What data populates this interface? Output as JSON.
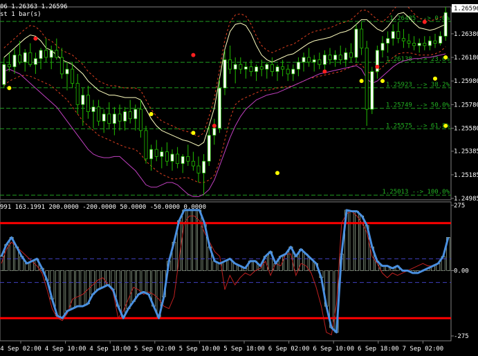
{
  "header": {
    "ohlc_text": "06 1.26363 1.26596",
    "shift_text": "st 1 bar(s)",
    "indicator_params": "991 163.1991 200.0000 -200.0000 50.0000 -50.0000 0.0000"
  },
  "colors": {
    "background": "#000000",
    "bull_candle": "#ffffff",
    "candle_outline": "#22c000",
    "bear_candle": "#000000",
    "upper_band": "#ffffc0",
    "envelope": "#e04020",
    "lower_band": "#c040c0",
    "fib_line": "#22a022",
    "fractal_up": "#ff2020",
    "fractal_down": "#ffff00",
    "cci_main": "#4a90e0",
    "cci_signal": "#c02020",
    "level_line": "#ff0000",
    "dash_level": "#4040c0"
  },
  "chart_data": [
    {
      "type": "candlestick",
      "price_axis_labels": [
        "1.26596",
        "1.26380",
        "1.26180",
        "1.25980",
        "1.25780",
        "1.25580",
        "1.25385",
        "1.25185",
        "1.24985"
      ],
      "current_price": "1.26596",
      "ylim": [
        1.24985,
        1.26596
      ],
      "fibonacci_levels": [
        {
          "label": "1.26485 --> 0.0%",
          "value": 1.26485
        },
        {
          "label": "1.26138 --> 23.6%",
          "value": 1.26138
        },
        {
          "label": "1.25923 --> 38.2%",
          "value": 1.25923
        },
        {
          "label": "1.25749 --> 50.0%",
          "value": 1.25749
        },
        {
          "label": "1.25575 --> 61.8%",
          "value": 1.25575
        },
        {
          "label": "1.25013 --> 100.0%",
          "value": 1.25013
        }
      ],
      "candles": [
        [
          1.2595,
          1.2618,
          1.2592,
          1.2612
        ],
        [
          1.2612,
          1.2622,
          1.2606,
          1.261
        ],
        [
          1.261,
          1.2626,
          1.2604,
          1.262
        ],
        [
          1.262,
          1.2632,
          1.2612,
          1.2614
        ],
        [
          1.2614,
          1.2625,
          1.2606,
          1.2622
        ],
        [
          1.2622,
          1.263,
          1.261,
          1.2612
        ],
        [
          1.2612,
          1.2622,
          1.2604,
          1.2617
        ],
        [
          1.2617,
          1.2626,
          1.2608,
          1.2624
        ],
        [
          1.2624,
          1.2634,
          1.2614,
          1.2618
        ],
        [
          1.2618,
          1.2628,
          1.2608,
          1.2624
        ],
        [
          1.2624,
          1.2634,
          1.2616,
          1.2618
        ],
        [
          1.2618,
          1.2626,
          1.26,
          1.2604
        ],
        [
          1.2604,
          1.2614,
          1.259,
          1.2608
        ],
        [
          1.2608,
          1.2614,
          1.2592,
          1.2596
        ],
        [
          1.2596,
          1.2604,
          1.257,
          1.2578
        ],
        [
          1.2578,
          1.2592,
          1.256,
          1.2586
        ],
        [
          1.2586,
          1.2594,
          1.2566,
          1.2572
        ],
        [
          1.2572,
          1.2582,
          1.2558,
          1.2576
        ],
        [
          1.2576,
          1.2582,
          1.256,
          1.2564
        ],
        [
          1.2564,
          1.2574,
          1.2554,
          1.257
        ],
        [
          1.257,
          1.258,
          1.2558,
          1.2562
        ],
        [
          1.2562,
          1.2576,
          1.2552,
          1.257
        ],
        [
          1.257,
          1.2578,
          1.2556,
          1.2564
        ],
        [
          1.2564,
          1.2576,
          1.2556,
          1.2572
        ],
        [
          1.2572,
          1.2582,
          1.2562,
          1.2566
        ],
        [
          1.2566,
          1.2578,
          1.2556,
          1.2574
        ],
        [
          1.2574,
          1.2582,
          1.255,
          1.2556
        ],
        [
          1.2556,
          1.256,
          1.2528,
          1.2532
        ],
        [
          1.2532,
          1.2544,
          1.2522,
          1.254
        ],
        [
          1.254,
          1.2548,
          1.253,
          1.2534
        ],
        [
          1.2534,
          1.2542,
          1.2524,
          1.2538
        ],
        [
          1.2538,
          1.2546,
          1.2526,
          1.253
        ],
        [
          1.253,
          1.254,
          1.2522,
          1.2536
        ],
        [
          1.2536,
          1.2542,
          1.2524,
          1.2528
        ],
        [
          1.2528,
          1.2536,
          1.252,
          1.2534
        ],
        [
          1.2534,
          1.2544,
          1.2526,
          1.253
        ],
        [
          1.253,
          1.2538,
          1.2522,
          1.2526
        ],
        [
          1.2526,
          1.2534,
          1.2512,
          1.252
        ],
        [
          1.252,
          1.2536,
          1.2501,
          1.253
        ],
        [
          1.253,
          1.256,
          1.2526,
          1.2552
        ],
        [
          1.2552,
          1.2566,
          1.2544,
          1.2558
        ],
        [
          1.2558,
          1.26,
          1.2554,
          1.2592
        ],
        [
          1.2592,
          1.2624,
          1.2586,
          1.2616
        ],
        [
          1.2616,
          1.2628,
          1.2604,
          1.2608
        ],
        [
          1.2608,
          1.2618,
          1.2596,
          1.2612
        ],
        [
          1.2612,
          1.2618,
          1.2604,
          1.2608
        ],
        [
          1.2608,
          1.2614,
          1.26,
          1.261
        ],
        [
          1.261,
          1.2616,
          1.2602,
          1.2606
        ],
        [
          1.2606,
          1.2612,
          1.2598,
          1.261
        ],
        [
          1.261,
          1.2616,
          1.2602,
          1.2608
        ],
        [
          1.2608,
          1.2614,
          1.26,
          1.2612
        ],
        [
          1.2612,
          1.2618,
          1.2602,
          1.2606
        ],
        [
          1.2606,
          1.2612,
          1.2598,
          1.261
        ],
        [
          1.261,
          1.2616,
          1.2602,
          1.2608
        ],
        [
          1.2608,
          1.2612,
          1.2598,
          1.2604
        ],
        [
          1.2604,
          1.2612,
          1.2598,
          1.2608
        ],
        [
          1.2608,
          1.2618,
          1.2602,
          1.2614
        ],
        [
          1.2614,
          1.2622,
          1.2606,
          1.2618
        ],
        [
          1.2618,
          1.2626,
          1.261,
          1.2614
        ],
        [
          1.2614,
          1.262,
          1.2606,
          1.2616
        ],
        [
          1.2616,
          1.2622,
          1.2608,
          1.2612
        ],
        [
          1.2612,
          1.2624,
          1.2606,
          1.262
        ],
        [
          1.262,
          1.2626,
          1.2612,
          1.2616
        ],
        [
          1.2616,
          1.2624,
          1.261,
          1.262
        ],
        [
          1.262,
          1.2628,
          1.2612,
          1.2616
        ],
        [
          1.2616,
          1.2626,
          1.261,
          1.2622
        ],
        [
          1.2622,
          1.263,
          1.2614,
          1.2618
        ],
        [
          1.2618,
          1.2646,
          1.2614,
          1.2642
        ],
        [
          1.2642,
          1.2648,
          1.262,
          1.2626
        ],
        [
          1.2626,
          1.2632,
          1.256,
          1.2574
        ],
        [
          1.2574,
          1.261,
          1.257,
          1.2606
        ],
        [
          1.2606,
          1.2628,
          1.26,
          1.2624
        ],
        [
          1.2624,
          1.2636,
          1.2618,
          1.263
        ],
        [
          1.263,
          1.264,
          1.2622,
          1.2634
        ],
        [
          1.2634,
          1.2646,
          1.2628,
          1.264
        ],
        [
          1.264,
          1.2648,
          1.263,
          1.2634
        ],
        [
          1.2634,
          1.2642,
          1.2626,
          1.2632
        ],
        [
          1.2632,
          1.2638,
          1.2626,
          1.263
        ],
        [
          1.263,
          1.2636,
          1.2624,
          1.2628
        ],
        [
          1.2628,
          1.2634,
          1.2622,
          1.263
        ],
        [
          1.263,
          1.2636,
          1.2624,
          1.2628
        ],
        [
          1.2628,
          1.2636,
          1.2624,
          1.2632
        ],
        [
          1.2632,
          1.2638,
          1.2626,
          1.263
        ],
        [
          1.263,
          1.264,
          1.2628,
          1.2636
        ],
        [
          1.2636,
          1.2662,
          1.2632,
          1.2656
        ]
      ],
      "upper_band": [
        1.2618,
        1.2622,
        1.2626,
        1.263,
        1.2634,
        1.2637,
        1.2636,
        1.2632,
        1.2626,
        1.2624,
        1.262,
        1.2616,
        1.2614,
        1.2612,
        1.2608,
        1.2604,
        1.2598,
        1.2594,
        1.259,
        1.2588,
        1.2586,
        1.2586,
        1.2585,
        1.2584,
        1.2584,
        1.2584,
        1.2582,
        1.2574,
        1.2566,
        1.256,
        1.2556,
        1.2554,
        1.2552,
        1.255,
        1.2548,
        1.2547,
        1.2545,
        1.2543,
        1.2546,
        1.256,
        1.2575,
        1.26,
        1.2625,
        1.264,
        1.2646,
        1.2647,
        1.2645,
        1.2638,
        1.2628,
        1.262,
        1.2616,
        1.2614,
        1.2616,
        1.2618,
        1.262,
        1.2621,
        1.2624,
        1.2627,
        1.263,
        1.2632,
        1.2633,
        1.2634,
        1.2635,
        1.2637,
        1.2639,
        1.264,
        1.2642,
        1.2646,
        1.265,
        1.265,
        1.2646,
        1.2642,
        1.264,
        1.2644,
        1.265,
        1.2655,
        1.2656,
        1.2652,
        1.2647,
        1.2643,
        1.2642,
        1.2641,
        1.2642,
        1.2644,
        1.2646
      ],
      "lower_band": [
        1.2594,
        1.2598,
        1.26,
        1.2602,
        1.2603,
        1.2602,
        1.26,
        1.2598,
        1.2596,
        1.2594,
        1.259,
        1.2586,
        1.2582,
        1.2576,
        1.257,
        1.2564,
        1.256,
        1.2556,
        1.2552,
        1.255,
        1.2548,
        1.2546,
        1.2544,
        1.2542,
        1.2541,
        1.254,
        1.2536,
        1.253,
        1.2526,
        1.2522,
        1.2519,
        1.2517,
        1.2515,
        1.2515,
        1.2516,
        1.2516,
        1.2514,
        1.2512,
        1.2512,
        1.2514,
        1.2518,
        1.253,
        1.2548,
        1.2566,
        1.2578,
        1.2582,
        1.2584,
        1.2586,
        1.2588,
        1.259,
        1.259,
        1.2591,
        1.2592,
        1.2593,
        1.2593,
        1.2594,
        1.2596,
        1.2598,
        1.26,
        1.2601,
        1.2602,
        1.2603,
        1.2604,
        1.2605,
        1.2606,
        1.2608,
        1.261,
        1.2612,
        1.2612,
        1.2606,
        1.2604,
        1.2606,
        1.261,
        1.2614,
        1.2618,
        1.2621,
        1.2622,
        1.2622,
        1.2621,
        1.262,
        1.262,
        1.262,
        1.2621,
        1.2623,
        1.2627
      ],
      "lower_band_2": [
        1.2606,
        1.2608,
        1.2606,
        1.2604,
        1.26,
        1.2596,
        1.2592,
        1.2588,
        1.2584,
        1.258,
        1.2576,
        1.257,
        1.2564,
        1.2558,
        1.2552,
        1.2546,
        1.254,
        1.2536,
        1.2534,
        1.2533,
        1.2533,
        1.2534,
        1.2534,
        1.253,
        1.2526,
        1.2522,
        1.2516,
        1.251,
        1.2508,
        1.2508,
        1.251,
        1.2512,
        1.2512,
        1.251,
        1.2506,
        1.2502,
        1.25,
        1.25,
        1.2502,
        1.2506,
        1.2514,
        1.2526,
        1.2538,
        1.255,
        1.256,
        1.2568,
        1.2574,
        1.2578,
        1.2582,
        1.2584,
        1.2586,
        1.2587,
        1.2588,
        1.259,
        1.2592,
        1.2594,
        1.2596,
        1.2598,
        1.26,
        1.2602,
        1.2604,
        1.2605,
        1.2606,
        1.2607,
        1.2608,
        1.2609,
        1.261,
        1.2611,
        1.2608,
        1.26,
        1.2596,
        1.2598,
        1.2602,
        1.2606,
        1.261,
        1.2613,
        1.2615,
        1.2616,
        1.2617,
        1.2617,
        1.2618,
        1.2618,
        1.2619,
        1.262,
        1.2621
      ],
      "fractals_up": [
        [
          6,
          1.2634
        ],
        [
          36,
          1.262
        ],
        [
          40,
          1.256
        ],
        [
          61,
          1.2606
        ],
        [
          71,
          1.261
        ],
        [
          80,
          1.2648
        ]
      ],
      "fractals_down": [
        [
          1,
          1.2592
        ],
        [
          28,
          1.257
        ],
        [
          36,
          1.2554
        ],
        [
          52,
          1.252
        ],
        [
          68,
          1.2598
        ],
        [
          72,
          1.2598
        ],
        [
          82,
          1.26
        ],
        [
          95,
          1.256
        ],
        [
          131,
          1.2618
        ]
      ]
    },
    {
      "type": "line",
      "indicator": "oscillator",
      "ylim": [
        -275,
        275
      ],
      "axis_labels": [
        "275",
        "0.00",
        "-275"
      ],
      "levels": [
        200,
        -200,
        50,
        -50,
        0
      ],
      "x_labels": [
        "4 Sep 02:00",
        "4 Sep 10:00",
        "4 Sep 18:00",
        "5 Sep 02:00",
        "5 Sep 10:00",
        "5 Sep 18:00",
        "6 Sep 02:00",
        "6 Sep 10:00",
        "6 Sep 18:00",
        "7 Sep 02:00"
      ],
      "main": [
        60,
        110,
        140,
        100,
        60,
        30,
        40,
        50,
        10,
        -40,
        -120,
        -190,
        -200,
        -170,
        -160,
        -150,
        -150,
        -140,
        -100,
        -80,
        -70,
        -60,
        -80,
        -150,
        -200,
        -160,
        -130,
        -100,
        -90,
        -100,
        -150,
        -200,
        -110,
        40,
        120,
        210,
        255,
        255,
        255,
        255,
        200,
        100,
        40,
        30,
        40,
        50,
        30,
        20,
        10,
        40,
        40,
        20,
        60,
        80,
        30,
        60,
        70,
        100,
        60,
        90,
        70,
        50,
        30,
        -30,
        -150,
        -240,
        -260,
        70,
        255,
        250,
        250,
        230,
        190,
        100,
        40,
        20,
        20,
        10,
        20,
        0,
        0,
        -10,
        -10,
        0,
        10,
        20,
        30,
        60,
        140
      ],
      "signal": [
        30,
        90,
        120,
        100,
        80,
        60,
        40,
        20,
        -10,
        -80,
        -160,
        -200,
        -210,
        -180,
        -120,
        -110,
        -100,
        -80,
        -60,
        -40,
        -30,
        -60,
        -90,
        -200,
        -170,
        -120,
        -70,
        -80,
        -100,
        -90,
        -100,
        -120,
        -150,
        -160,
        -110,
        50,
        200,
        230,
        230,
        210,
        160,
        120,
        80,
        60,
        -80,
        -20,
        -60,
        -30,
        -10,
        -20,
        0,
        10,
        40,
        -20,
        30,
        20,
        70,
        70,
        -20,
        30,
        20,
        -10,
        -70,
        -150,
        -260,
        -270,
        -140,
        200,
        240,
        250,
        230,
        200,
        160,
        60,
        30,
        -10,
        -30,
        -10,
        -20,
        -10,
        0,
        10,
        20,
        30,
        20,
        20,
        30
      ]
    }
  ]
}
